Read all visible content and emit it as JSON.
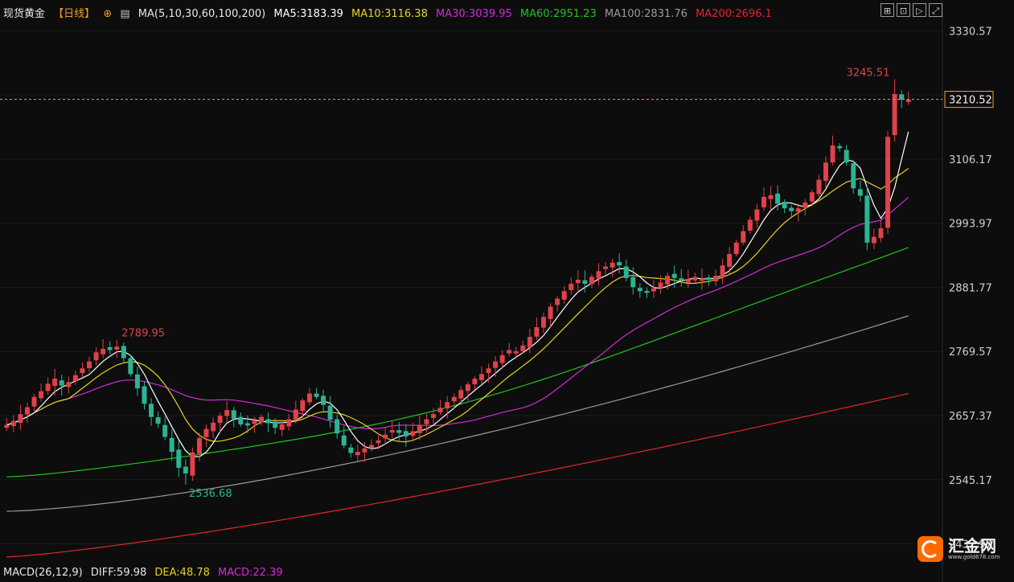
{
  "header": {
    "symbol": "现货黄金",
    "period": "【日线】",
    "ma_params": "MA(5,10,30,60,100,200)",
    "ma5": "MA5:3183.39",
    "ma10": "MA10:3116.38",
    "ma30": "MA30:3039.95",
    "ma60": "MA60:2951.23",
    "ma100": "MA100:2831.76",
    "ma200": "MA200:2696.1"
  },
  "footer": {
    "macd_params": "MACD(26,12,9)",
    "diff": "DIFF:59.98",
    "dea": "DEA:48.78",
    "macd": "MACD:22.39"
  },
  "toolbar": {
    "icons": [
      "zoom-in-icon",
      "fit-icon",
      "play-icon",
      "expand-icon"
    ]
  },
  "logo": {
    "text": "汇金网",
    "url": "www.gold678.com"
  },
  "colors": {
    "background": "#0d0d0d",
    "up": "#e0414a",
    "down": "#2cb394",
    "ma5": "#ffffff",
    "ma10": "#e4d41c",
    "ma30": "#d22bd8",
    "ma60": "#1fc41f",
    "ma100": "#9a9a9a",
    "ma200": "#e3262d",
    "last_price_line": "#f0a030",
    "axis_text": "#cfcfcf"
  },
  "chart_data": {
    "type": "candlestick",
    "y_ticks": [
      "3330.57",
      "3218.37",
      "3106.17",
      "2993.97",
      "2881.77",
      "2769.57",
      "2657.37",
      "2545.17",
      "2432.97"
    ],
    "ylim": [
      2400,
      3345
    ],
    "current_price": "3210.52",
    "annotations": {
      "high": {
        "label": "3245.51",
        "value": 3245.51
      },
      "low": {
        "label": "2536.68",
        "value": 2536.68
      },
      "swing_high": {
        "label": "2789.95",
        "value": 2789.95
      }
    },
    "candle_count": 146,
    "closes": [
      2641,
      2648,
      2660,
      2672,
      2690,
      2700,
      2713,
      2722,
      2710,
      2716,
      2728,
      2740,
      2752,
      2768,
      2774,
      2772,
      2778,
      2758,
      2730,
      2705,
      2678,
      2655,
      2643,
      2620,
      2594,
      2566,
      2556,
      2593,
      2618,
      2634,
      2645,
      2657,
      2667,
      2652,
      2642,
      2640,
      2648,
      2655,
      2644,
      2636,
      2642,
      2651,
      2668,
      2684,
      2696,
      2690,
      2676,
      2650,
      2626,
      2605,
      2592,
      2594,
      2600,
      2606,
      2614,
      2624,
      2632,
      2627,
      2621,
      2630,
      2641,
      2651,
      2660,
      2671,
      2681,
      2690,
      2702,
      2712,
      2722,
      2730,
      2740,
      2752,
      2763,
      2772,
      2770,
      2780,
      2795,
      2812,
      2830,
      2848,
      2862,
      2875,
      2888,
      2895,
      2888,
      2900,
      2910,
      2918,
      2925,
      2920,
      2898,
      2882,
      2875,
      2872,
      2880,
      2890,
      2902,
      2898,
      2893,
      2896,
      2900,
      2897,
      2895,
      2902,
      2920,
      2940,
      2960,
      2980,
      3000,
      3018,
      3040,
      3043,
      3028,
      3020,
      3015,
      3020,
      3030,
      3048,
      3070,
      3100,
      3130,
      3125,
      3100,
      3055,
      3042,
      2960,
      2970,
      2985,
      3145,
      3220,
      3210,
      3210
    ],
    "ma_series": [
      {
        "name": "MA5"
      },
      {
        "name": "MA10"
      },
      {
        "name": "MA30"
      },
      {
        "name": "MA60"
      },
      {
        "name": "MA100"
      },
      {
        "name": "MA200"
      }
    ]
  }
}
